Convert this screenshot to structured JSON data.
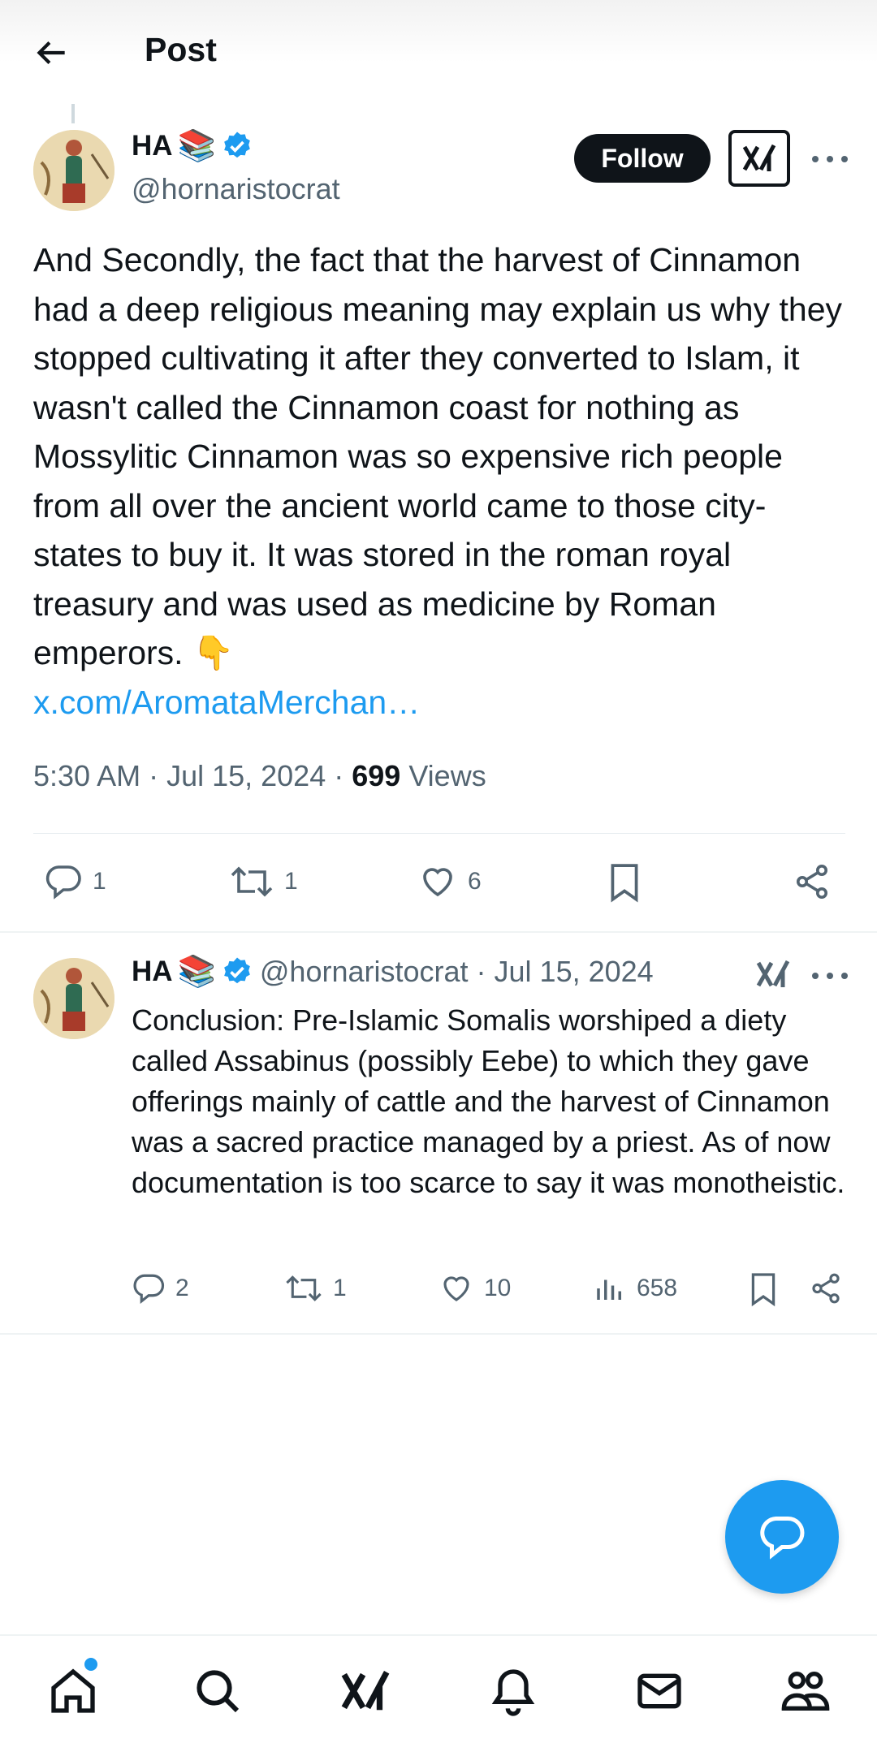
{
  "header": {
    "title": "Post"
  },
  "main_post": {
    "author_name": "HA",
    "author_emoji": "📚",
    "handle": "@hornaristocrat",
    "follow_label": "Follow",
    "text": "And Secondly, the fact that the harvest of Cinnamon had a deep religious meaning may explain us why they stopped cultivating it after they converted to Islam, it wasn't called the Cinnamon coast for nothing as Mossylitic Cinnamon was so expensive rich people from all over the ancient world came to those city-states to buy it. It was stored in the roman royal treasury and was used as medicine by Roman emperors. 👇",
    "link": "x.com/AromataMerchan…",
    "timestamp": "5:30 AM · Jul 15, 2024 · ",
    "views_count": "699",
    "views_label": " Views",
    "replies": "1",
    "reposts": "1",
    "likes": "6"
  },
  "reply_post": {
    "author_name": "HA",
    "author_emoji": "📚",
    "handle_date": "@hornaristocrat · Jul 15, 2024",
    "text": "Conclusion: Pre-Islamic Somalis worshiped a diety called Assabinus (possibly Eebe) to which they gave offerings mainly of cattle and the harvest of Cinnamon was a sacred practice managed by a priest. As of now documentation is too scarce to say it was monotheistic.",
    "replies": "2",
    "reposts": "1",
    "likes": "10",
    "views": "658"
  },
  "colors": {
    "accent": "#1d9bf0",
    "text": "#0f1419",
    "secondary": "#536471"
  },
  "nav": [
    "home-icon",
    "search-icon",
    "grok-icon",
    "notifications-icon",
    "messages-icon",
    "communities-icon"
  ]
}
